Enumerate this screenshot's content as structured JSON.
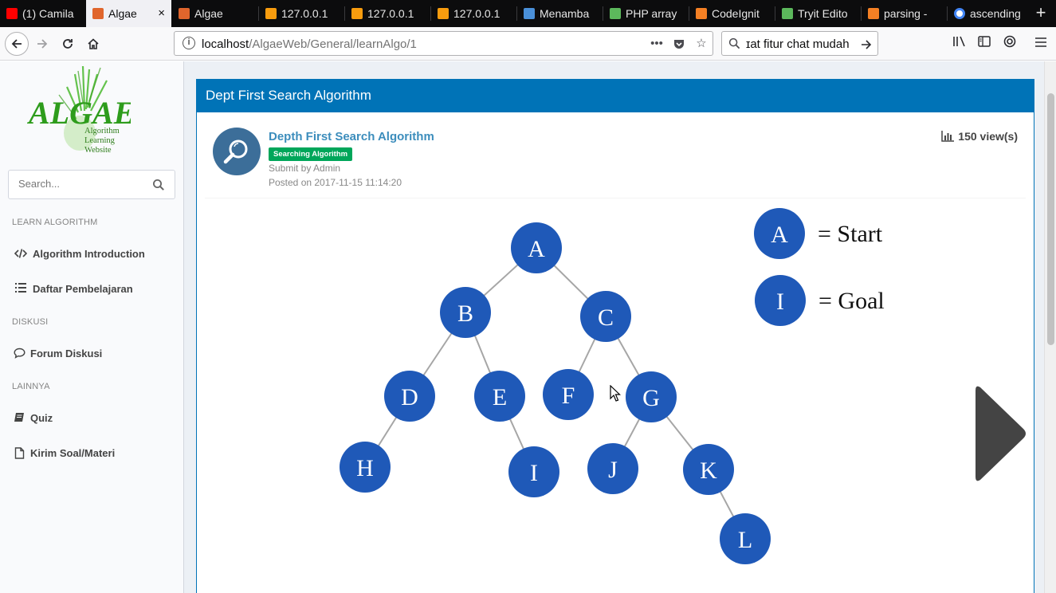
{
  "browser": {
    "tabs": [
      {
        "label": "(1) Camila",
        "icon_color": "#ff0000",
        "active": false
      },
      {
        "label": "Algae",
        "icon_color": "#e0652c",
        "active": true
      },
      {
        "label": "Algae",
        "icon_color": "#e0652c",
        "active": false
      },
      {
        "label": "127.0.0.1",
        "icon_color": "#f89c0e",
        "active": false
      },
      {
        "label": "127.0.0.1",
        "icon_color": "#f89c0e",
        "active": false
      },
      {
        "label": "127.0.0.1",
        "icon_color": "#f89c0e",
        "active": false
      },
      {
        "label": "Menamba",
        "icon_color": "#4a90d9",
        "active": false
      },
      {
        "label": "PHP array",
        "icon_color": "#5cb85c",
        "active": false
      },
      {
        "label": "CodeIgnit",
        "icon_color": "#f48024",
        "active": false
      },
      {
        "label": "Tryit Edito",
        "icon_color": "#5cb85c",
        "active": false
      },
      {
        "label": "parsing - ",
        "icon_color": "#f48024",
        "active": false
      },
      {
        "label": "ascending",
        "icon_color": "#4285f4",
        "active": false
      }
    ],
    "close_glyph": "×",
    "new_tab_glyph": "+",
    "url": {
      "host": "localhost",
      "path": "/AlgaeWeb/General/learnAlgo/1"
    },
    "search_query": "ɪat fitur chat mudah"
  },
  "sidebar": {
    "logo": {
      "word": "ALGAE",
      "line1": "Algorithm",
      "line2": "Learning",
      "line3": "Website"
    },
    "search_placeholder": "Search...",
    "sections": [
      {
        "header": "LEARN ALGORITHM",
        "items": [
          {
            "label": "Algorithm Introduction",
            "icon": "code-icon"
          },
          {
            "label": "Daftar Pembelajaran",
            "icon": "list-icon"
          }
        ]
      },
      {
        "header": "DISKUSI",
        "items": [
          {
            "label": "Forum Diskusi",
            "icon": "comment-icon"
          }
        ]
      },
      {
        "header": "LAINNYA",
        "items": [
          {
            "label": "Quiz",
            "icon": "book-icon"
          },
          {
            "label": "Kirim Soal/Materi",
            "icon": "file-icon"
          }
        ]
      }
    ]
  },
  "box": {
    "header_title": "Dept First Search Algorithm",
    "post_title": "Depth First Search Algorithm",
    "category_badge": "Searching Algorithm",
    "submitted_by": "Submit by Admin",
    "posted_on": "Posted on 2017-11-15 11:14:20",
    "views": "150 view(s)"
  },
  "graph": {
    "node_color": "#1f59b8",
    "nodes": [
      "A",
      "B",
      "C",
      "D",
      "E",
      "F",
      "G",
      "H",
      "I",
      "J",
      "K",
      "L"
    ],
    "edges": [
      [
        "A",
        "B"
      ],
      [
        "A",
        "C"
      ],
      [
        "B",
        "D"
      ],
      [
        "B",
        "E"
      ],
      [
        "C",
        "F"
      ],
      [
        "C",
        "G"
      ],
      [
        "D",
        "H"
      ],
      [
        "E",
        "I"
      ],
      [
        "G",
        "J"
      ],
      [
        "G",
        "K"
      ],
      [
        "K",
        "L"
      ]
    ],
    "legend": [
      {
        "node": "A",
        "text": "= Start"
      },
      {
        "node": "I",
        "text": "= Goal"
      }
    ]
  }
}
